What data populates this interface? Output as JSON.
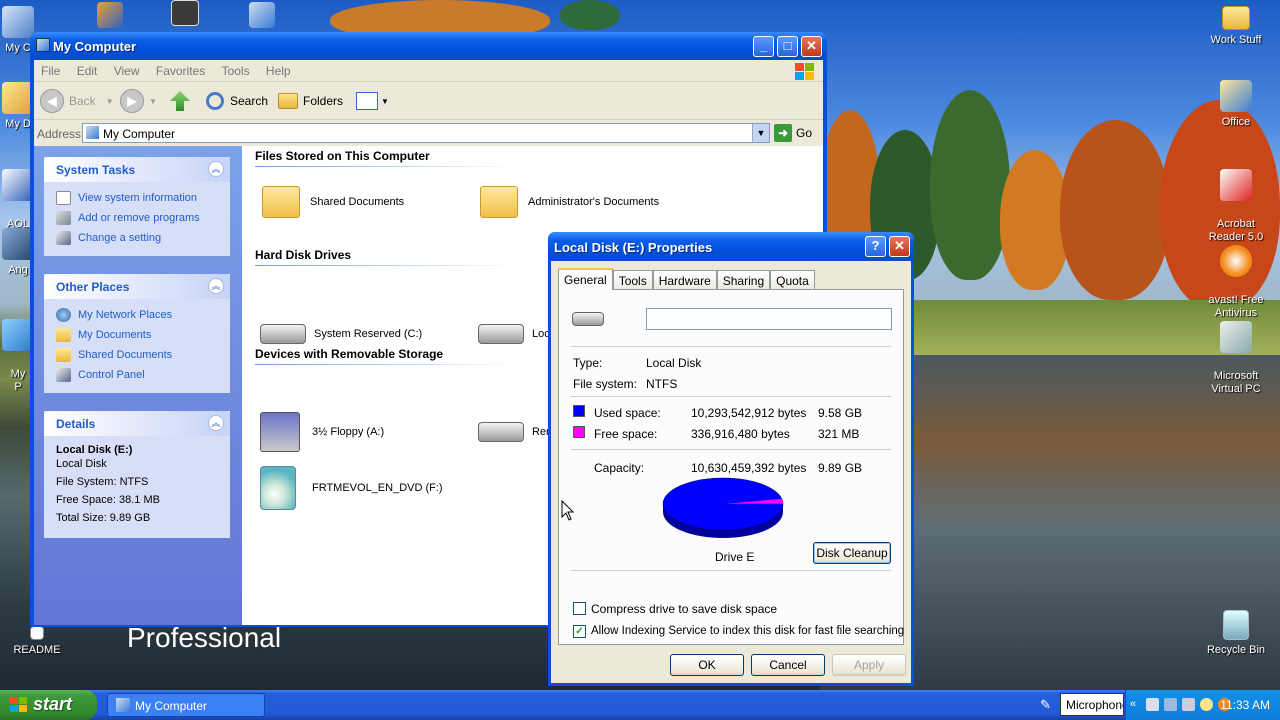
{
  "desktop": {
    "overlay_text": "Professional",
    "left_icons": [
      {
        "label": "My C"
      },
      {
        "label": "My D"
      },
      {
        "label": "AOL\nMes"
      },
      {
        "label": "Ang"
      },
      {
        "label": "My\nP"
      }
    ],
    "right_icons": [
      {
        "label": "Work Stuff"
      },
      {
        "label": "Office"
      },
      {
        "label": "Acrobat\nReader 5.0"
      },
      {
        "label": "avast! Free\nAntivirus"
      },
      {
        "label": "Microsoft\nVirtual PC"
      },
      {
        "label": "Recycle Bin"
      }
    ],
    "readme_label": "README"
  },
  "explorer": {
    "title": "My Computer",
    "menu": [
      "File",
      "Edit",
      "View",
      "Favorites",
      "Tools",
      "Help"
    ],
    "toolbar": {
      "back": "Back",
      "search": "Search",
      "folders": "Folders"
    },
    "address": {
      "label": "Address",
      "value": "My Computer",
      "go": "Go"
    },
    "system_tasks": {
      "title": "System Tasks",
      "items": [
        "View system information",
        "Add or remove programs",
        "Change a setting"
      ]
    },
    "other_places": {
      "title": "Other Places",
      "items": [
        "My Network Places",
        "My Documents",
        "Shared Documents",
        "Control Panel"
      ]
    },
    "details": {
      "title": "Details",
      "name": "Local Disk (E:)",
      "type": "Local Disk",
      "file_system": "File System: NTFS",
      "free_space": "Free Space: 38.1 MB",
      "total_size": "Total Size: 9.89 GB"
    },
    "groups": {
      "files": {
        "title": "Files Stored on This Computer",
        "items": [
          "Shared Documents",
          "Administrator's Documents"
        ]
      },
      "hard_disks": {
        "title": "Hard Disk Drives",
        "items": [
          "System Reserved (C:)",
          "Loca"
        ]
      },
      "removable": {
        "title": "Devices with Removable Storage",
        "items": [
          "3½ Floppy (A:)",
          "Rem",
          "FRTMEVOL_EN_DVD (F:)"
        ]
      }
    }
  },
  "properties": {
    "title": "Local Disk (E:) Properties",
    "tabs": [
      "General",
      "Tools",
      "Hardware",
      "Sharing",
      "Quota"
    ],
    "active_tab": "General",
    "volume_label_value": "",
    "type_label": "Type:",
    "type_value": "Local Disk",
    "fs_label": "File system:",
    "fs_value": "NTFS",
    "used_label": "Used space:",
    "used_bytes": "10,293,542,912 bytes",
    "used_size": "9.58 GB",
    "free_label": "Free space:",
    "free_bytes": "336,916,480 bytes",
    "free_size": "321 MB",
    "capacity_label": "Capacity:",
    "capacity_bytes": "10,630,459,392 bytes",
    "capacity_size": "9.89 GB",
    "drive_label": "Drive E",
    "disk_cleanup": "Disk Cleanup",
    "compress_label": "Compress drive to save disk space",
    "compress_checked": false,
    "index_label": "Allow Indexing Service to index this disk for fast file searching",
    "index_checked": true,
    "ok": "OK",
    "cancel": "Cancel",
    "apply": "Apply",
    "colors": {
      "used": "#0000ff",
      "free": "#ff00ff"
    },
    "used_fraction": 0.968
  },
  "taskbar": {
    "start": "start",
    "task_button": "My Computer",
    "language_bar": "Microphone",
    "clock": "11:33 AM"
  }
}
